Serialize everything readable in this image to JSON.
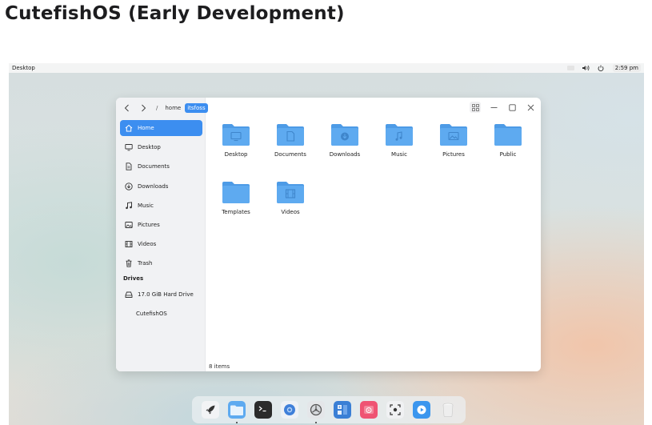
{
  "page": {
    "heading": "CutefishOS (Early Development)"
  },
  "topbar": {
    "title": "Desktop",
    "clock": "2:59 pm"
  },
  "breadcrumb": {
    "separator": "/",
    "items": [
      "home",
      "itsfoss"
    ]
  },
  "sidebar": {
    "items": [
      {
        "label": "Home",
        "icon": "home-icon"
      },
      {
        "label": "Desktop",
        "icon": "monitor-icon"
      },
      {
        "label": "Documents",
        "icon": "document-icon"
      },
      {
        "label": "Downloads",
        "icon": "download-icon"
      },
      {
        "label": "Music",
        "icon": "music-note-icon"
      },
      {
        "label": "Pictures",
        "icon": "picture-icon"
      },
      {
        "label": "Videos",
        "icon": "film-icon"
      },
      {
        "label": "Trash",
        "icon": "trash-icon"
      }
    ],
    "drives_header": "Drives",
    "drives": [
      {
        "label": "17.0 GiB Hard Drive",
        "icon": "hard-drive-icon"
      },
      {
        "label": "CutefishOS"
      }
    ]
  },
  "folders": [
    {
      "label": "Desktop",
      "emblem": "monitor-icon"
    },
    {
      "label": "Documents",
      "emblem": "document-icon"
    },
    {
      "label": "Downloads",
      "emblem": "download-icon"
    },
    {
      "label": "Music",
      "emblem": "music-note-icon"
    },
    {
      "label": "Pictures",
      "emblem": "picture-icon"
    },
    {
      "label": "Public",
      "emblem": "none"
    },
    {
      "label": "Templates",
      "emblem": "none"
    },
    {
      "label": "Videos",
      "emblem": "film-icon"
    }
  ],
  "status": {
    "count": "8 items"
  },
  "colors": {
    "accent": "#3c8ef0",
    "folder": "#5eaaf0",
    "folder_tab": "#4d9be6"
  },
  "dock": {
    "items": [
      {
        "name": "launcher",
        "icon": "rocket-icon",
        "running": false
      },
      {
        "name": "file-manager",
        "icon": "folder-icon",
        "running": true
      },
      {
        "name": "terminal",
        "icon": "terminal-icon",
        "running": false
      },
      {
        "name": "browser",
        "icon": "browser-icon",
        "running": false
      },
      {
        "name": "settings",
        "icon": "settings-icon",
        "running": true
      },
      {
        "name": "calculator",
        "icon": "calculator-icon",
        "running": false
      },
      {
        "name": "music-player",
        "icon": "music-player-icon",
        "running": false
      },
      {
        "name": "screenshot",
        "icon": "screenshot-icon",
        "running": false
      },
      {
        "name": "video-player",
        "icon": "play-icon",
        "running": false
      },
      {
        "name": "trash",
        "icon": "trash-can-icon",
        "running": false
      }
    ]
  }
}
